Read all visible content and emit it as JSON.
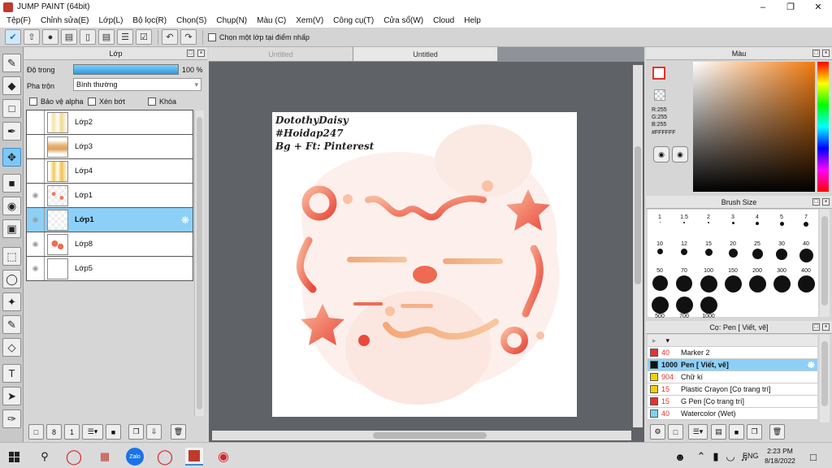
{
  "app": {
    "title": "JUMP PAINT (64bit)"
  },
  "menu": [
    "Tệp(F)",
    "Chỉnh sửa(E)",
    "Lớp(L)",
    "Bộ lọc(R)",
    "Chọn(S)",
    "Chụp(N)",
    "Màu (C)",
    "Xem(V)",
    "Công cụ(T)",
    "Cửa sổ(W)",
    "Cloud",
    "Help"
  ],
  "toolbar": {
    "pick_layer_label": "Chọn một lớp tại điểm nhấp"
  },
  "layer_panel": {
    "title": "Lớp",
    "opacity_label": "Độ trong",
    "opacity_value": "100 %",
    "opacity": 1.0,
    "blend_label": "Pha trộn",
    "blend_value": "Bình thường",
    "protect_alpha": "Bảo vệ alpha",
    "clip": "Xén bớt",
    "lock": "Khóa",
    "layers": [
      {
        "name": "Lớp2",
        "selected": false
      },
      {
        "name": "Lớp3",
        "selected": false
      },
      {
        "name": "Lớp4",
        "selected": false
      },
      {
        "name": "Lớp1",
        "selected": false
      },
      {
        "name": "Lớp1",
        "selected": true
      },
      {
        "name": "Lớp8",
        "selected": false
      },
      {
        "name": "Lớp5",
        "selected": false
      }
    ]
  },
  "canvas": {
    "tabs": [
      "Untitled",
      "Untitled"
    ],
    "watermark": [
      "DotothyDaisy",
      "#Hoidap247",
      "Bg + Ft: Pinterest"
    ]
  },
  "color_panel": {
    "title": "Màu",
    "r": "R:255",
    "g": "G:255",
    "b": "B:255",
    "hex": "#FFFFFF",
    "accent": "#e8322b"
  },
  "brush_size": {
    "title": "Brush Size",
    "sizes": [
      "1",
      "1.5",
      "2",
      "3",
      "4",
      "5",
      "7",
      "10",
      "12",
      "15",
      "20",
      "25",
      "30",
      "40",
      "50",
      "70",
      "100",
      "150",
      "200",
      "300",
      "400",
      "500",
      "700",
      "1000"
    ]
  },
  "brush_panel": {
    "title": "Cọ: Pen [ Viết, vẽ]",
    "items": [
      {
        "size": "40",
        "name": "Marker 2",
        "color": "#e83232",
        "selected": false
      },
      {
        "size": "1000",
        "name": "Pen [ Viết, vẽ]",
        "color": "#111111",
        "selected": true
      },
      {
        "size": "904",
        "name": "Chữ kí",
        "color": "#f0d400",
        "selected": false
      },
      {
        "size": "15",
        "name": "Plastic Crayon [Cọ trang trí]",
        "color": "#f0d400",
        "selected": false
      },
      {
        "size": "15",
        "name": "G Pen [Cọ trang trí]",
        "color": "#e83232",
        "selected": false
      },
      {
        "size": "40",
        "name": "Watercolor (Wet)",
        "color": "#7fd3f0",
        "selected": false
      }
    ]
  },
  "taskbar": {
    "lang": "ENG",
    "time": "2:23 PM",
    "date": "8/18/2022"
  }
}
